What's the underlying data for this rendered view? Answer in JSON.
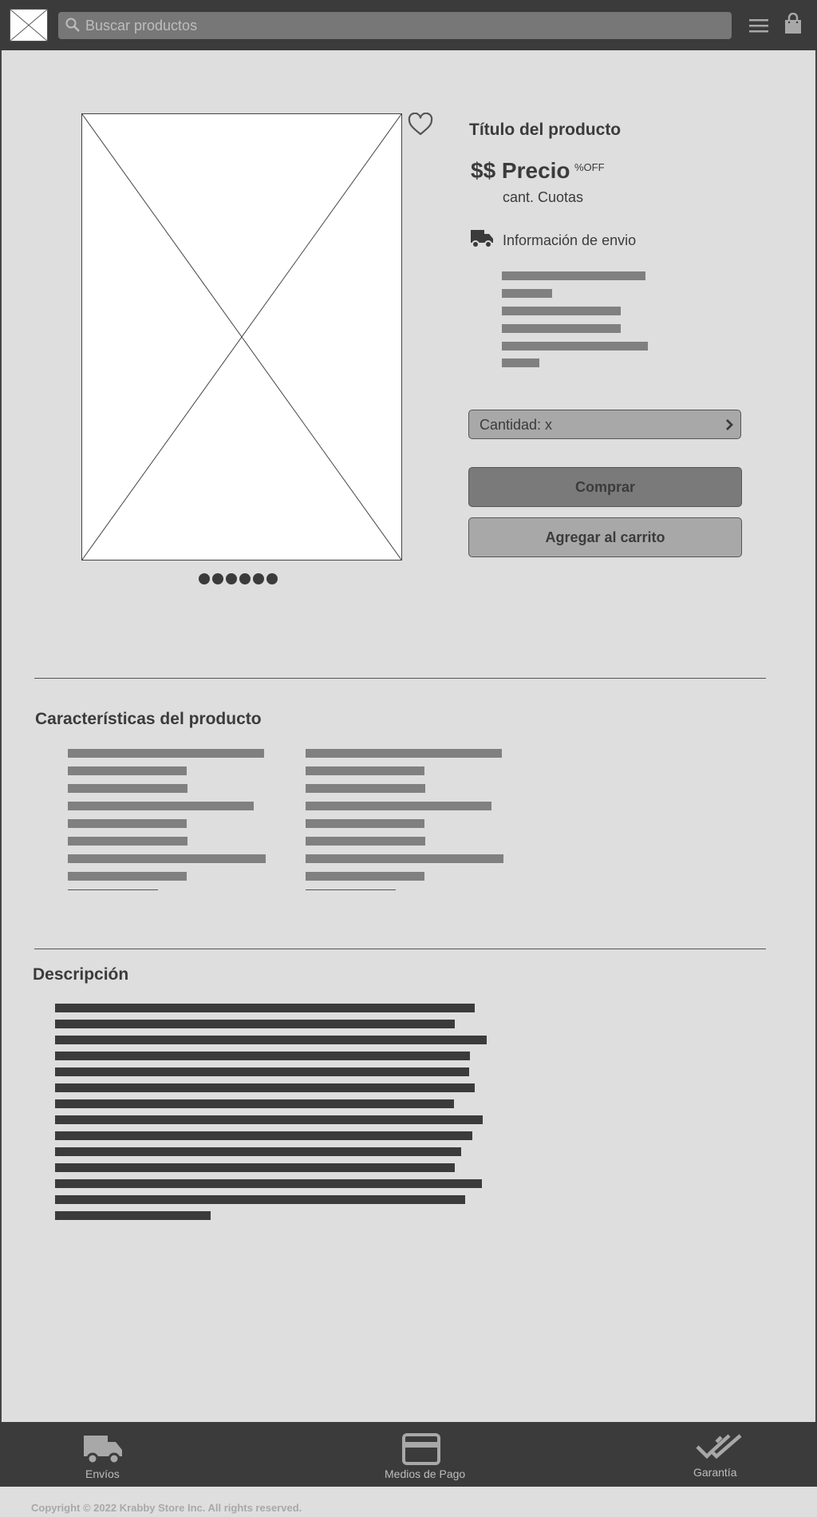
{
  "header": {
    "search_placeholder": "Buscar productos",
    "icons": [
      "logo-image-placeholder",
      "search-icon",
      "menu-icon",
      "shopping-bag-icon"
    ]
  },
  "product": {
    "title": "Título del producto",
    "price": "$$ Precio",
    "discount": "%OFF",
    "installments": "cant. Cuotas",
    "shipping_info": "Información de envio",
    "quantity_label": "Cantidad: x",
    "buy_button": "Comprar",
    "add_to_cart_button": "Agregar al carrito",
    "carousel_dot_count": 6
  },
  "features": {
    "title": "Características del producto"
  },
  "description": {
    "title": "Descripción"
  },
  "bottom_nav": {
    "items": [
      {
        "label": "Envíos",
        "icon": "truck-icon"
      },
      {
        "label": "Medios de Pago",
        "icon": "credit-card-icon"
      },
      {
        "label": "Garantía",
        "icon": "double-check-icon"
      }
    ]
  },
  "footer": {
    "copyright": "Copyright © 2022 Krabby Store Inc. All rights reserved."
  },
  "colors": {
    "background": "#dedede",
    "header": "#3b3b3b",
    "text": "#3b3b3b",
    "placeholder_bars": "#808080",
    "description_bars": "#3b3b3b",
    "buy_button": "#7a7a7a",
    "cart_button": "#a8a8a8"
  }
}
